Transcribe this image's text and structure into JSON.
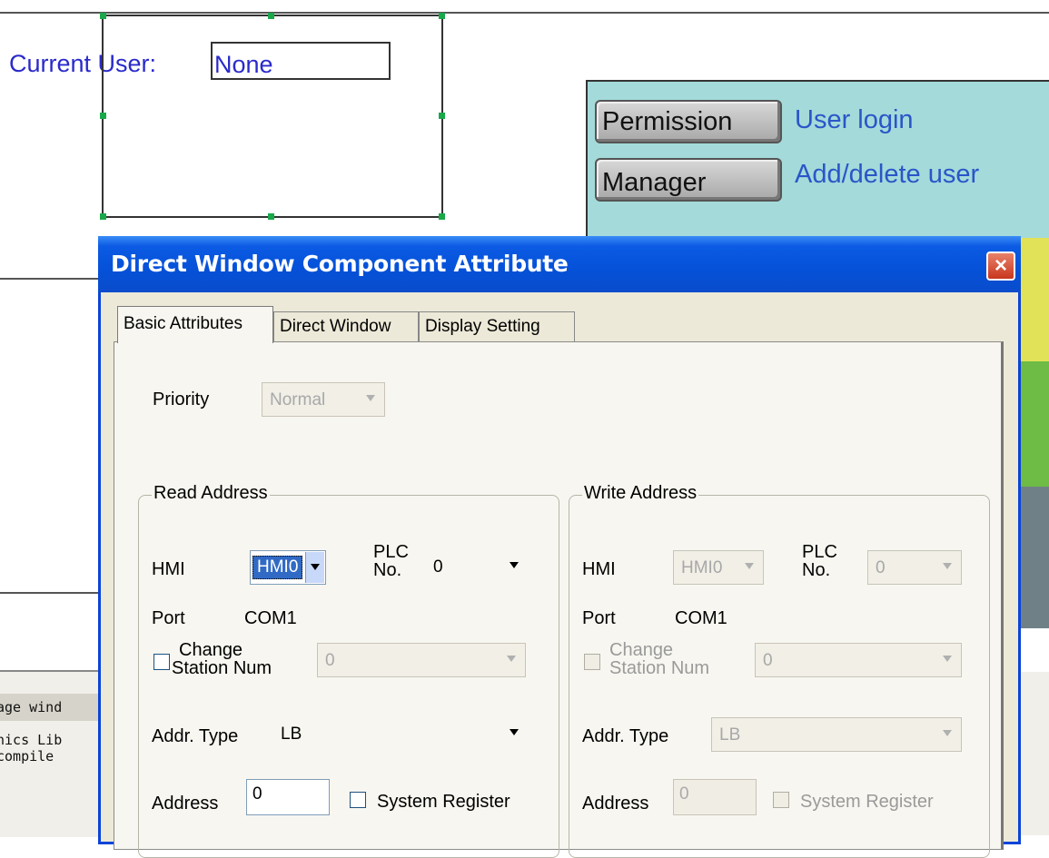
{
  "canvas": {
    "current_user_label": "Current User:",
    "current_user_value": "None",
    "buttons": [
      {
        "label": "Permission",
        "note": "User login"
      },
      {
        "label": "Manager",
        "note": "Add/delete user"
      }
    ]
  },
  "output": {
    "lines": [
      "age wind",
      "hics Lib",
      "compile"
    ]
  },
  "dialog": {
    "title": "Direct Window Component Attribute",
    "close": "×",
    "tabs": [
      "Basic Attributes",
      "Direct Window",
      "Display Setting"
    ],
    "priority_label": "Priority",
    "priority_value": "Normal",
    "read": {
      "caption": "Read Address",
      "hmi_label": "HMI",
      "hmi_value": "HMI0",
      "plc_label_1": "PLC",
      "plc_label_2": "No.",
      "plc_value": "0",
      "port_label": "Port",
      "port_value": "COM1",
      "station_label_1": "Change",
      "station_label_2": "Station Num",
      "station_value": "0",
      "addr_type_label": "Addr. Type",
      "addr_type_value": "LB",
      "address_label": "Address",
      "address_value": "0",
      "system_register_label": "System Register"
    },
    "write": {
      "caption": "Write Address",
      "hmi_label": "HMI",
      "hmi_value": "HMI0",
      "plc_label_1": "PLC",
      "plc_label_2": "No.",
      "plc_value": "0",
      "port_label": "Port",
      "port_value": "COM1",
      "station_label_1": "Change",
      "station_label_2": "Station Num",
      "station_value": "0",
      "addr_type_label": "Addr. Type",
      "addr_type_value": "LB",
      "address_label": "Address",
      "address_value": "0",
      "system_register_label": "System Register"
    }
  },
  "colors": {
    "title_blue": "#0551d8",
    "canvas_text": "#2a2acb",
    "panel_teal": "#a4dada",
    "selection_handle": "#19a84a"
  }
}
